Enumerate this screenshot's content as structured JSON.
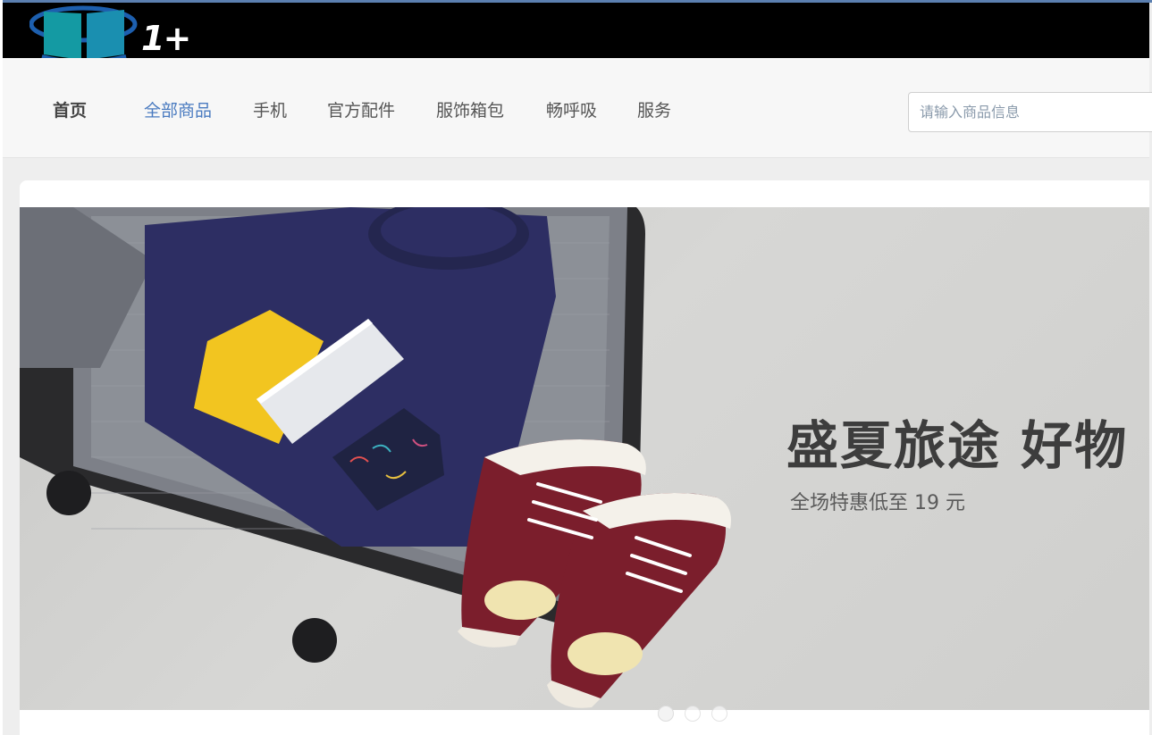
{
  "header": {
    "logo_text": "1+"
  },
  "nav": {
    "items": [
      {
        "label": "首页"
      },
      {
        "label": "全部商品"
      },
      {
        "label": "手机"
      },
      {
        "label": "官方配件"
      },
      {
        "label": "服饰箱包"
      },
      {
        "label": "畅呼吸"
      },
      {
        "label": "服务"
      }
    ],
    "active_index": 1
  },
  "search": {
    "placeholder": "请输入商品信息",
    "value": ""
  },
  "banner": {
    "headline": "盛夏旅途 好物",
    "subline": "全场特惠低至 19 元",
    "slide_count": 3,
    "active_slide": 1
  },
  "colors": {
    "topbar": "#000000",
    "nav_active": "#4a7bc0",
    "logo_blue": "#1d5fae",
    "logo_teal": "#149aa3"
  }
}
